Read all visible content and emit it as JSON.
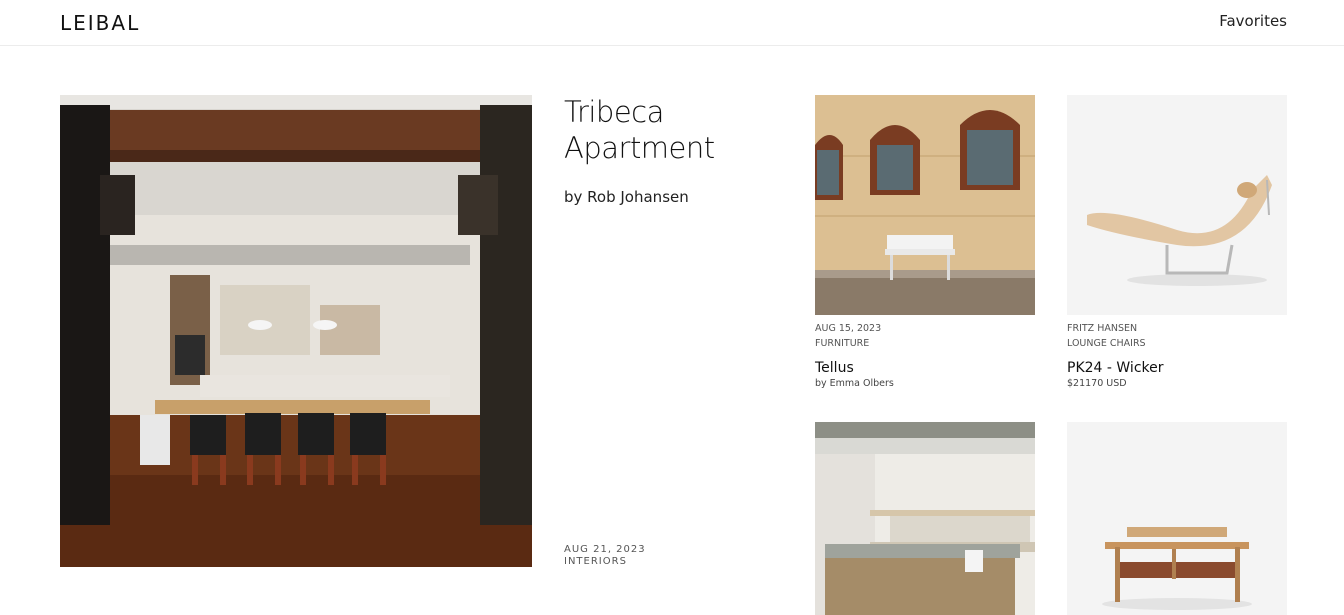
{
  "header": {
    "logo": "LEIBAL",
    "favorites_label": "Favorites"
  },
  "feature": {
    "title": "Tribeca Apartment",
    "author": "by Rob Johansen",
    "date": "AUG 21, 2023",
    "category": "INTERIORS"
  },
  "cards": [
    {
      "meta1": "AUG 15, 2023",
      "meta2": "FURNITURE",
      "name": "Tellus",
      "sub": "by Emma Olbers"
    },
    {
      "meta1": "FRITZ HANSEN",
      "meta2": "LOUNGE CHAIRS",
      "name": "PK24 - Wicker",
      "sub": "$21170 USD"
    }
  ]
}
